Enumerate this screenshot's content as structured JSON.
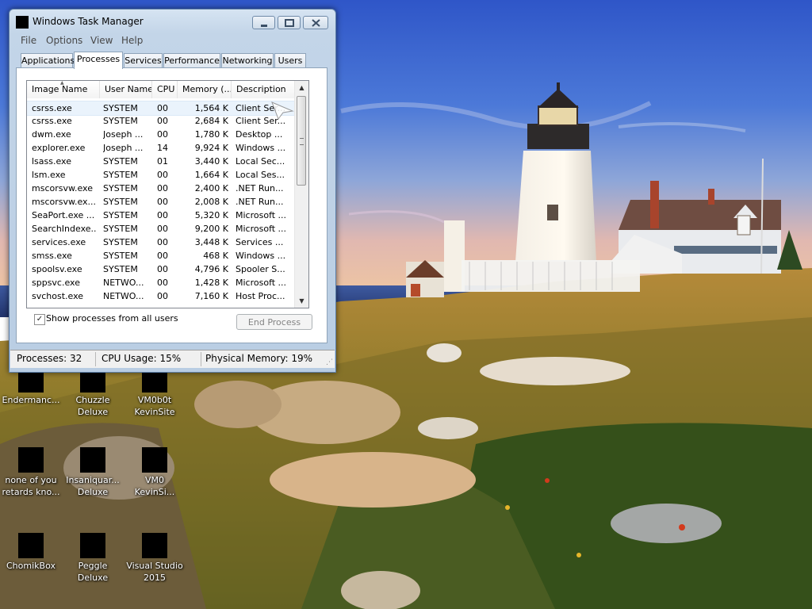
{
  "window": {
    "title": "Windows Task Manager",
    "menu": [
      "File",
      "Options",
      "View",
      "Help"
    ],
    "tabs": [
      "Applications",
      "Processes",
      "Services",
      "Performance",
      "Networking",
      "Users"
    ],
    "active_tab": "Processes"
  },
  "process_table": {
    "columns": [
      "Image Name",
      "User Name",
      "CPU",
      "Memory (...",
      "Description"
    ],
    "rows": [
      {
        "name": "csrss.exe",
        "user": "SYSTEM",
        "cpu": "00",
        "memory": "1,564 K",
        "description": "Client Ser..."
      },
      {
        "name": "csrss.exe",
        "user": "SYSTEM",
        "cpu": "00",
        "memory": "2,684 K",
        "description": "Client Ser..."
      },
      {
        "name": "dwm.exe",
        "user": "Joseph ...",
        "cpu": "00",
        "memory": "1,780 K",
        "description": "Desktop ..."
      },
      {
        "name": "explorer.exe",
        "user": "Joseph ...",
        "cpu": "14",
        "memory": "9,924 K",
        "description": "Windows ..."
      },
      {
        "name": "lsass.exe",
        "user": "SYSTEM",
        "cpu": "01",
        "memory": "3,440 K",
        "description": "Local Sec..."
      },
      {
        "name": "lsm.exe",
        "user": "SYSTEM",
        "cpu": "00",
        "memory": "1,664 K",
        "description": "Local Ses..."
      },
      {
        "name": "mscorsvw.exe",
        "user": "SYSTEM",
        "cpu": "00",
        "memory": "2,400 K",
        "description": ".NET Run..."
      },
      {
        "name": "mscorsvw.ex...",
        "user": "SYSTEM",
        "cpu": "00",
        "memory": "2,008 K",
        "description": ".NET Run..."
      },
      {
        "name": "SeaPort.exe ...",
        "user": "SYSTEM",
        "cpu": "00",
        "memory": "5,320 K",
        "description": "Microsoft ..."
      },
      {
        "name": "SearchIndexe...",
        "user": "SYSTEM",
        "cpu": "00",
        "memory": "9,200 K",
        "description": "Microsoft ..."
      },
      {
        "name": "services.exe",
        "user": "SYSTEM",
        "cpu": "00",
        "memory": "3,448 K",
        "description": "Services ..."
      },
      {
        "name": "smss.exe",
        "user": "SYSTEM",
        "cpu": "00",
        "memory": "468 K",
        "description": "Windows ..."
      },
      {
        "name": "spoolsv.exe",
        "user": "SYSTEM",
        "cpu": "00",
        "memory": "4,796 K",
        "description": "Spooler S..."
      },
      {
        "name": "sppsvc.exe",
        "user": "NETWO...",
        "cpu": "00",
        "memory": "1,428 K",
        "description": "Microsoft ..."
      },
      {
        "name": "svchost.exe",
        "user": "NETWO...",
        "cpu": "00",
        "memory": "7,160 K",
        "description": "Host Proc..."
      }
    ]
  },
  "controls": {
    "show_all_label": "Show processes from all users",
    "show_all_checked": true,
    "end_process_label": "End Process"
  },
  "statusbar": {
    "processes": "Processes: 32",
    "cpu": "CPU Usage: 15%",
    "memory": "Physical Memory: 19%"
  },
  "desktop_icons": [
    {
      "label": "Endermanc..."
    },
    {
      "label": "Chuzzle\nDeluxe"
    },
    {
      "label": "VM0b0t\nKevinSite"
    },
    {
      "label": "none of you\nretards kno..."
    },
    {
      "label": "Insaniquar...\nDeluxe"
    },
    {
      "label": "VM0\nKevinSi..."
    },
    {
      "label": "ChomikBox"
    },
    {
      "label": "Peggle Deluxe"
    },
    {
      "label": "Visual Studio\n2015"
    }
  ],
  "icons": {
    "minimize": "minimize-icon",
    "maximize": "maximize-icon",
    "close": "close-icon",
    "sort": "sort-ascending-icon",
    "cursor": "mouse-cursor-icon"
  },
  "colors": {
    "title_bar": "#c3d5e8",
    "selected_row": "#eaf3fc",
    "disabled_text": "#838383"
  }
}
